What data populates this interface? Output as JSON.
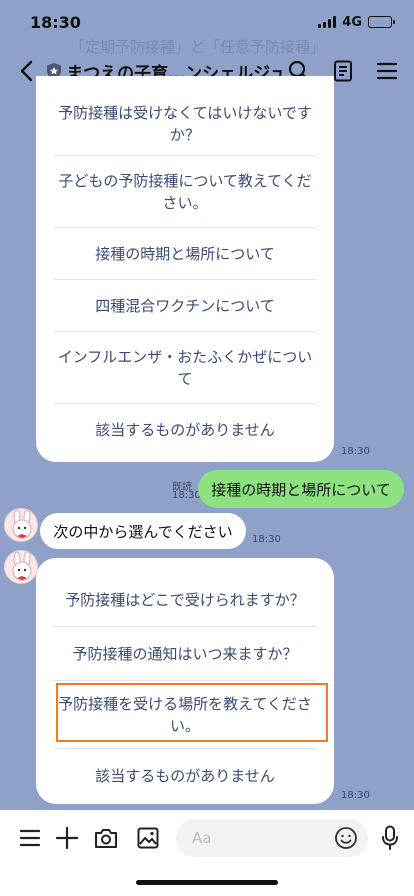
{
  "status": {
    "time": "18:30",
    "network": "4G"
  },
  "header": {
    "title": "まつえの子育…ンシェルジュ",
    "background_text": "「定期予防接種」と「任意予防接種」"
  },
  "card1": {
    "items": [
      "予防接種は受けなくてはいけないですか？",
      "子どもの予防接種について教えてください。",
      "接種の時期と場所について",
      "四種混合ワクチンについて",
      "インフルエンザ・おたふくかぜについて",
      "該当するものがありません"
    ],
    "time": "18:30"
  },
  "sent": {
    "text": "接種の時期と場所について",
    "read_label": "既読",
    "time": "18:30"
  },
  "received": {
    "text": "次の中から選んでください",
    "time": "18:30"
  },
  "card2": {
    "items": [
      "予防接種はどこで受けられますか？",
      "予防接種の通知はいつ来ますか？",
      "予防接種を受ける場所を教えてください。",
      "該当するものがありません"
    ],
    "time": "18:30"
  },
  "input": {
    "placeholder": "Aa"
  },
  "colors": {
    "background": "#8fa1c9",
    "sent_bubble": "#8de180",
    "highlight": "#ef7b25",
    "link_text": "#3d4a73"
  }
}
